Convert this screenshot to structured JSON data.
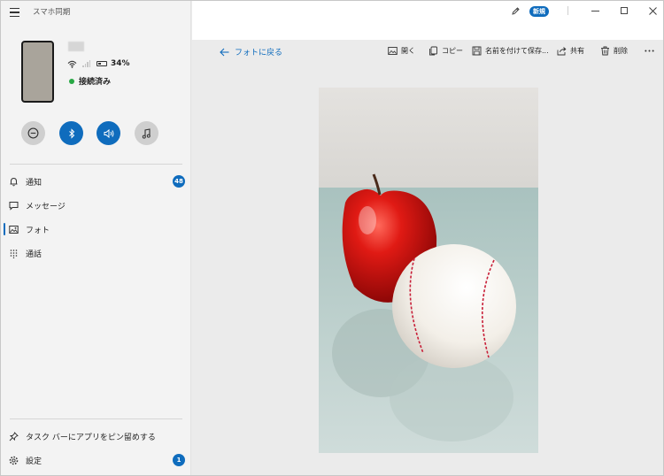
{
  "app": {
    "title": "スマホ同期"
  },
  "device": {
    "battery": "34%",
    "connection_status": "接続済み"
  },
  "quick_actions": [
    {
      "name": "do-not-disturb",
      "icon": "minus-circle-icon"
    },
    {
      "name": "bluetooth",
      "icon": "bluetooth-icon"
    },
    {
      "name": "audio",
      "icon": "speaker-icon"
    },
    {
      "name": "media",
      "icon": "music-note-icon"
    }
  ],
  "nav": {
    "notifications": {
      "label": "通知",
      "badge": "48"
    },
    "messages": {
      "label": "メッセージ"
    },
    "photos": {
      "label": "フォト"
    },
    "calls": {
      "label": "通話"
    }
  },
  "bottom": {
    "pin": {
      "label": "タスク バーにアプリをピン留めする"
    },
    "settings": {
      "label": "設定",
      "badge": "1"
    }
  },
  "titlebar": {
    "new_badge": "新規"
  },
  "toolbar": {
    "back_label": "フォトに戻る",
    "open_label": "開く",
    "copy_label": "コピー",
    "save_as_label": "名前を付けて保存...",
    "share_label": "共有",
    "delete_label": "削除"
  },
  "colors": {
    "accent": "#0f6cbd",
    "connected": "#28a845"
  }
}
